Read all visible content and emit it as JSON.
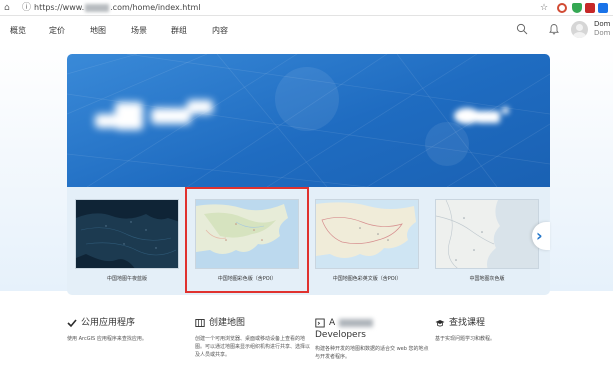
{
  "browser": {
    "url_prefix": "https://www.",
    "url_suffix": ".com/home/index.html",
    "home_icon": "home-icon",
    "info_icon": "info-icon",
    "star_icon": "star-icon"
  },
  "nav": {
    "items": [
      "概览",
      "定价",
      "地图",
      "场景",
      "群组",
      "内容"
    ],
    "user_name": "Dom",
    "user_sub": "Dom"
  },
  "gallery": {
    "items": [
      {
        "label": "中国地图午夜蓝版"
      },
      {
        "label": "中国地图彩色版（含POI）"
      },
      {
        "label": "中国地图色彩英文版（含POI）"
      },
      {
        "label": "中国地图灰色版"
      }
    ],
    "next_glyph": "›"
  },
  "features": [
    {
      "title": "公用应用程序",
      "desc": "使用 ArcGIS 应用程序来查找应用。"
    },
    {
      "title": "创建地图",
      "desc": "创建一个可用浏览器、桌面或移动设备上查看的地图。可以通过地图来显示组织机构进行共享、选择以及人员或共享。"
    },
    {
      "title": "A",
      "title2": "Developers",
      "desc": "构建各种开发的地图和数据的适合交 web 您的地点与开发者程序。"
    },
    {
      "title": "查找课程",
      "desc": "基于实现问题学习和教程。"
    }
  ],
  "colors": {
    "accent": "#2275c9",
    "highlight": "#e0322f",
    "hero_blue": "#1f6cc1"
  }
}
